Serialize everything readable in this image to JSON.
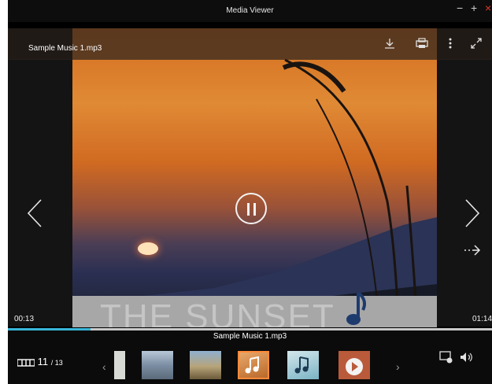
{
  "window": {
    "title": "Media Viewer",
    "controls": [
      "−",
      "+",
      "×"
    ]
  },
  "header": {
    "file_name": "Sample Music 1.mp3"
  },
  "album": {
    "text": "THE SUNSET"
  },
  "playback": {
    "elapsed": "00:13",
    "total": "01:14",
    "progress_fraction": 0.17,
    "now_playing": "Sample Music 1.mp3"
  },
  "counter": {
    "current": "11",
    "total": "/ 13"
  },
  "thumbnails": [
    "snow-field",
    "mountain-lake",
    "castle",
    "music-note",
    "music-file",
    "video-play"
  ],
  "colors": {
    "accent": "#38b4d8",
    "selected": "#ff8a3a"
  }
}
